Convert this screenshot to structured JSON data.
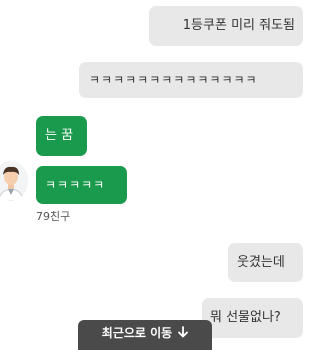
{
  "messages": [
    {
      "side": "out",
      "text": "1등쿠폰 미리 줘도됨"
    },
    {
      "side": "out",
      "text": "ㅋㅋㅋㅋㅋㅋㅋㅋㅋㅋㅋㅋㅋㅋ"
    },
    {
      "side": "in",
      "text": "는 꿈"
    },
    {
      "side": "in",
      "text": "ㅋㅋㅋㅋㅋ"
    },
    {
      "side": "out",
      "text": "웃겼는데"
    },
    {
      "side": "out",
      "text": "뭐 선물없나?"
    }
  ],
  "sender": {
    "name": "79친구",
    "avatar_icon": "person-avatar-icon"
  },
  "jump_button": {
    "label": "최근으로 이동",
    "icon": "arrow-down-icon"
  },
  "colors": {
    "incoming_bubble": "#1a9a4c",
    "outgoing_bubble": "#e8e8e8",
    "jump_button_bg": "#4a4a4a"
  }
}
